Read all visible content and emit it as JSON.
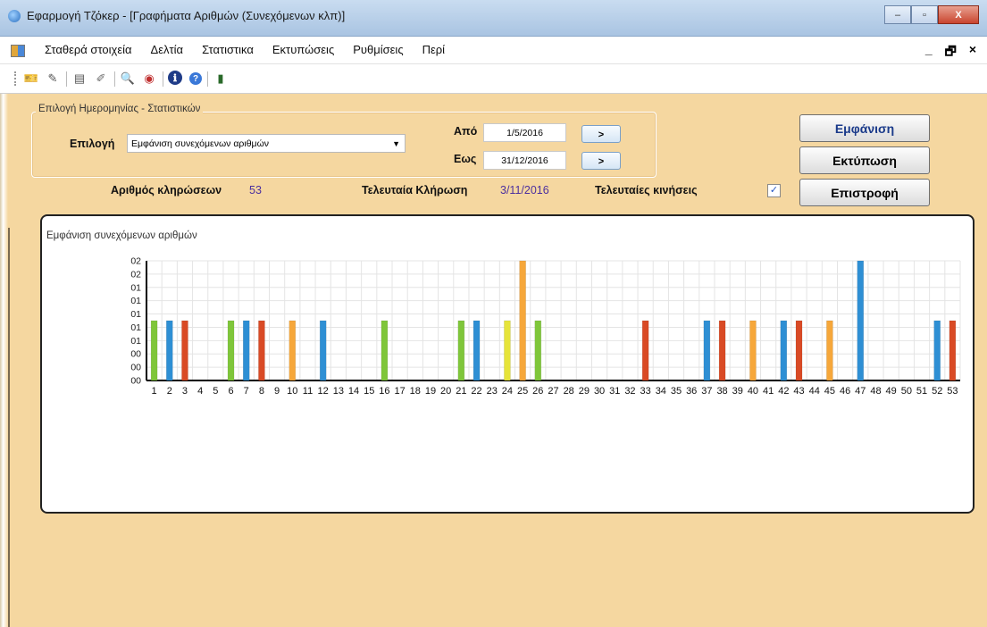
{
  "window": {
    "title": "Εφαρμογή Τζόκερ - [Γραφήματα Αριθμών (Συνεχόμενων κλπ)]",
    "minimize": "–",
    "maximize": "▫",
    "close": "X"
  },
  "menu": {
    "items": [
      "Σταθερά στοιχεία",
      "Δελτία",
      "Στατιστικα",
      "Εκτυπώσεις",
      "Ρυθμίσεις",
      "Περί"
    ],
    "mdi_controls": [
      "_",
      "🗗",
      "×"
    ]
  },
  "toolbar": {
    "icons": [
      "ticket-icon",
      "edit-icon",
      "document-icon",
      "chart-icon",
      "search-icon",
      "globe-icon",
      "info-icon",
      "help-icon",
      "exit-door-icon"
    ],
    "glyphs": [
      "🎫",
      "✎",
      "▤",
      "✐",
      "🔍",
      "◉",
      "ℹ",
      "?",
      "▮"
    ]
  },
  "form": {
    "group_title": "Επιλογή Ημερομηνίας - Στατιστικών",
    "selection_label": "Επιλογή",
    "selection_value": "Εμφάνιση συνεχόμενων αριθμών",
    "from_label": "Από",
    "from_value": "1/5/2016",
    "to_label": "Εως",
    "to_value": "31/12/2016",
    "arrow_button": ">",
    "draws_label": "Αριθμός κληρώσεων",
    "draws_value": "53",
    "last_draw_label": "Τελευταία Κλήρωση",
    "last_draw_value": "3/11/2016",
    "last_moves_label": "Τελευταίες κινήσεις",
    "last_moves_checked": "✓"
  },
  "buttons": {
    "show": "Εμφάνιση",
    "print": "Εκτύπωση",
    "back": "Επιστροφή"
  },
  "colors": {
    "background": "#f5d7a0",
    "green": "#7fc63a",
    "blue": "#2e8fd4",
    "red": "#d94a25",
    "orange": "#f6a73a",
    "yellow": "#e6e43a",
    "value_text": "#4b2f9f"
  },
  "chart_data": {
    "type": "bar",
    "title": "Εμφάνιση συνεχόμενων αριθμών",
    "ytick_labels": [
      "00",
      "00",
      "00",
      "01",
      "01",
      "01",
      "01",
      "01",
      "02",
      "02"
    ],
    "ylim": [
      0,
      2
    ],
    "categories": [
      "1",
      "2",
      "3",
      "4",
      "5",
      "6",
      "7",
      "8",
      "9",
      "10",
      "11",
      "12",
      "13",
      "14",
      "15",
      "16",
      "17",
      "18",
      "19",
      "20",
      "21",
      "22",
      "23",
      "24",
      "25",
      "26",
      "27",
      "28",
      "29",
      "30",
      "31",
      "32",
      "33",
      "34",
      "35",
      "36",
      "37",
      "38",
      "39",
      "40",
      "41",
      "42",
      "43",
      "44",
      "45",
      "46",
      "47",
      "48",
      "49",
      "50",
      "51",
      "52",
      "53"
    ],
    "values": [
      1,
      1,
      1,
      0,
      0,
      1,
      1,
      1,
      0,
      1,
      0,
      1,
      0,
      0,
      0,
      1,
      0,
      0,
      0,
      0,
      1,
      1,
      0,
      1,
      2,
      1,
      0,
      0,
      0,
      0,
      0,
      0,
      1,
      0,
      0,
      0,
      1,
      1,
      0,
      1,
      0,
      1,
      1,
      0,
      1,
      0,
      2,
      0,
      0,
      0,
      0,
      1,
      1
    ],
    "bar_colors": [
      "green",
      "blue",
      "red",
      "",
      "",
      "green",
      "blue",
      "red",
      "",
      "orange",
      "",
      "blue",
      "",
      "",
      "",
      "green",
      "",
      "",
      "",
      "",
      "green",
      "blue",
      "",
      "yellow",
      "orange",
      "green",
      "",
      "",
      "",
      "",
      "",
      "",
      "red",
      "",
      "",
      "",
      "blue",
      "red",
      "",
      "orange",
      "",
      "blue",
      "red",
      "",
      "orange",
      "",
      "blue",
      "",
      "",
      "",
      "",
      "blue",
      "red"
    ],
    "grid": true
  }
}
